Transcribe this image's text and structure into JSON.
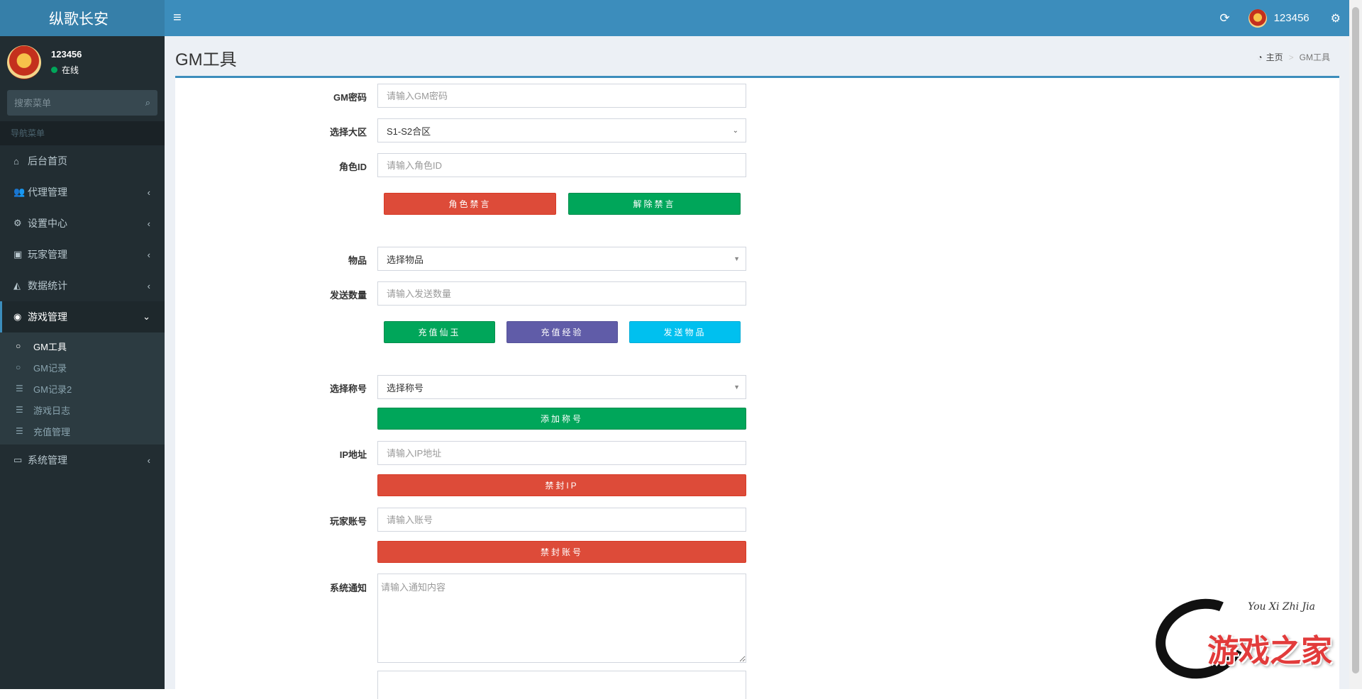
{
  "header": {
    "brand": "纵歌长安",
    "toggle_icon": "bars-icon",
    "username": "123456"
  },
  "sidebar": {
    "user_name": "123456",
    "user_status": "在线",
    "search_placeholder": "搜索菜单",
    "nav_header": "导航菜单",
    "items": [
      {
        "label": "后台首页",
        "icon": "home-icon"
      },
      {
        "label": "代理管理",
        "icon": "users-icon"
      },
      {
        "label": "设置中心",
        "icon": "cogs-icon"
      },
      {
        "label": "玩家管理",
        "icon": "address-book-icon"
      },
      {
        "label": "数据统计",
        "icon": "area-chart-icon"
      },
      {
        "label": "游戏管理",
        "icon": "gamepad-icon"
      },
      {
        "label": "系统管理",
        "icon": "desktop-icon"
      }
    ],
    "submenu": [
      {
        "label": "GM工具",
        "icon": "circle-o-icon"
      },
      {
        "label": "GM记录",
        "icon": "circle-o-icon"
      },
      {
        "label": "GM记录2",
        "icon": "list-icon"
      },
      {
        "label": "游戏日志",
        "icon": "list-icon"
      },
      {
        "label": "充值管理",
        "icon": "list-icon"
      }
    ]
  },
  "page": {
    "title": "GM工具",
    "breadcrumb_home": "主页",
    "breadcrumb_current": "GM工具"
  },
  "form": {
    "gm_password_label": "GM密码",
    "gm_password_placeholder": "请输入GM密码",
    "region_label": "选择大区",
    "region_value": "S1-S2合区",
    "role_id_label": "角色ID",
    "role_id_placeholder": "请输入角色ID",
    "mute_button": "角色禁言",
    "unmute_button": "解除禁言",
    "item_label": "物品",
    "item_value": "选择物品",
    "quantity_label": "发送数量",
    "quantity_placeholder": "请输入发送数量",
    "recharge_jade_button": "充值仙玉",
    "recharge_exp_button": "充值经验",
    "send_item_button": "发送物品",
    "title_label": "选择称号",
    "title_value": "选择称号",
    "add_title_button": "添加称号",
    "ip_label": "IP地址",
    "ip_placeholder": "请输入IP地址",
    "ban_ip_button": "禁封IP",
    "account_label": "玩家账号",
    "account_placeholder": "请输入账号",
    "ban_account_button": "禁封账号",
    "notice_label": "系统通知",
    "notice_placeholder": "请输入通知内容"
  },
  "watermark": {
    "title": "游戏之家",
    "subtitle": "You Xi Zhi Jia"
  },
  "colors": {
    "header": "#3c8dbc",
    "sidebar": "#222d32",
    "red": "#dd4b39",
    "green": "#00a65a",
    "purple": "#605ca8",
    "cyan": "#00c0ef"
  }
}
